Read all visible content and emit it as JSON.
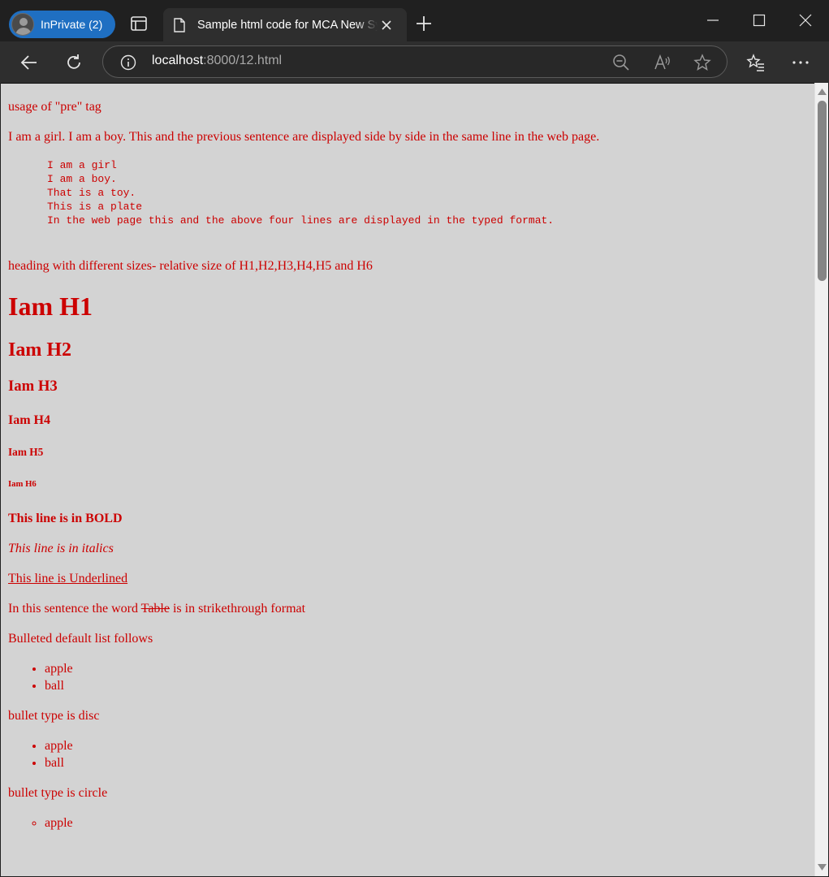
{
  "browser": {
    "profile_label": "InPrivate (2)",
    "tab_title": "Sample html code for MCA New Syllabus",
    "url_host": "localhost",
    "url_rest": ":8000/12.html",
    "accent_color": "#1f6fc2"
  },
  "content": {
    "pre_heading": "usage of \"pre\" tag",
    "inline_sentence": "I am a girl. I am a boy. This and the previous sentence are displayed side by side in the same line in the web page.",
    "pre_lines": "I am a girl\nI am a boy.\nThat is a toy.\nThis is a plate\nIn the web page this and the above four lines are displayed in the typed format.",
    "headings_intro": "heading with different sizes- relative size of H1,H2,H3,H4,H5 and H6",
    "h1": "Iam H1",
    "h2": "Iam H2",
    "h3": "Iam H3",
    "h4": "Iam H4",
    "h5": "Iam H5",
    "h6": "Iam H6",
    "bold_line": "This line is in BOLD",
    "italic_line": "This line is in italics",
    "underline_line": "This line is Underlined",
    "strike_before": "In this sentence the word ",
    "strike_word": "Table",
    "strike_after": " is in strikethrough format",
    "list1_title": "Bulleted default list follows",
    "list1_items": [
      "apple",
      "ball"
    ],
    "list2_title": "bullet type is disc",
    "list2_items": [
      "apple",
      "ball"
    ],
    "list3_title": "bullet type is circle",
    "list3_items": [
      "apple"
    ],
    "text_color": "#cc0000",
    "background_color": "#d3d3d3"
  }
}
